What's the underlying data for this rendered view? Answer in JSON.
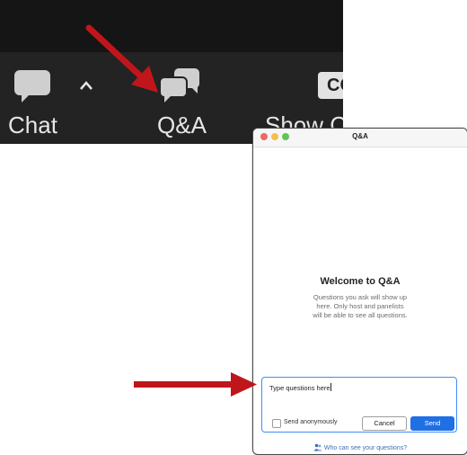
{
  "toolbar": {
    "chat_label": "Chat",
    "qa_label": "Q&A",
    "captions_label": "Show Ca",
    "cc_badge": "CC",
    "icons": [
      "chat-bubble-icon",
      "caret-up-icon",
      "qa-bubbles-icon",
      "closed-captions-icon"
    ]
  },
  "qa_window": {
    "title": "Q&A",
    "welcome_title": "Welcome to Q&A",
    "welcome_line1": "Questions you ask will show up",
    "welcome_line2": "here. Only host and panelists",
    "welcome_line3": "will be able to see all questions.",
    "input_value": "Type questions here",
    "send_anonymously_label": "Send anonymously",
    "cancel_label": "Cancel",
    "send_label": "Send",
    "footer_link": "Who can see your questions?"
  },
  "colors": {
    "toolbar_bg": "#232323",
    "annotation_arrow": "#c0161b",
    "send_button": "#1f6fe5",
    "input_focus": "#3f8cf5"
  }
}
